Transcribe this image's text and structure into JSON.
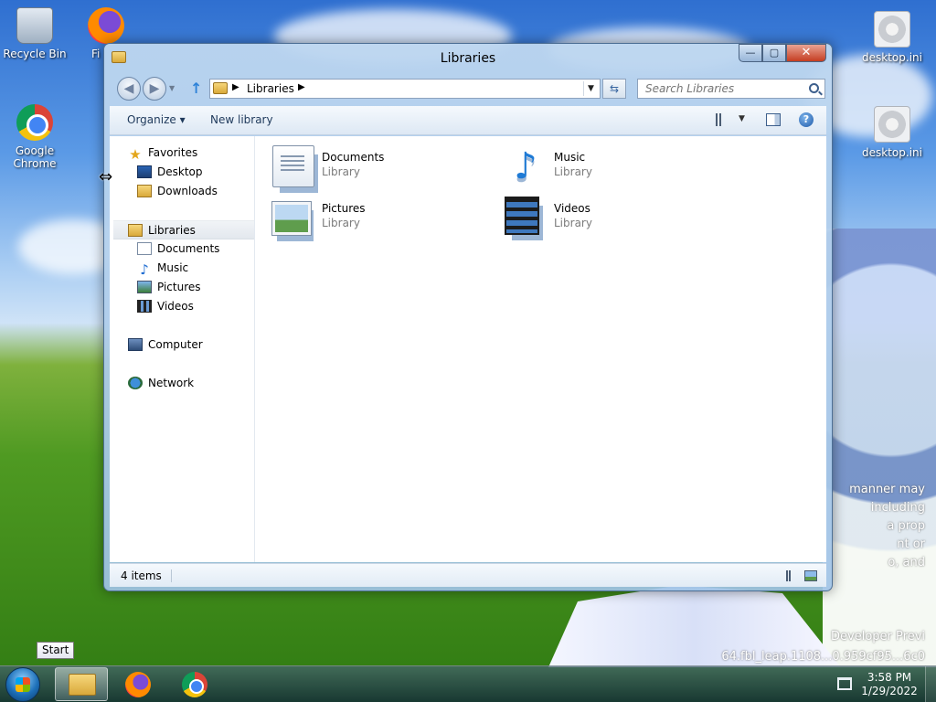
{
  "desktop": {
    "icons": [
      {
        "label": "Recycle Bin"
      },
      {
        "label": "Fi"
      },
      {
        "label": "Google Chrome"
      },
      {
        "label": "desktop.ini"
      },
      {
        "label": "desktop.ini"
      }
    ],
    "watermark": {
      "line1": "manner may",
      "line2": "including",
      "line3": "a prop",
      "line4": "nt or",
      "line5": "o, and",
      "line6": "Developer Previ",
      "line7": "64.fbl_leap.1108...0.959cf95...6c0"
    }
  },
  "window": {
    "title": "Libraries",
    "caption": {
      "minimize": "—",
      "maximize": "▢",
      "close": "✕"
    },
    "nav": {
      "back": "◀",
      "forward": "▶",
      "history": "▼",
      "up": "↑",
      "address_path": "Libraries",
      "refresh": "⇆",
      "search_placeholder": "Search Libraries"
    },
    "toolbar": {
      "organize": "Organize ▾",
      "new_library": "New library",
      "help": "?"
    },
    "navpane": {
      "favorites": "Favorites",
      "desktop": "Desktop",
      "downloads": "Downloads",
      "libraries": "Libraries",
      "documents": "Documents",
      "music": "Music",
      "pictures": "Pictures",
      "videos": "Videos",
      "computer": "Computer",
      "network": "Network"
    },
    "libraries": [
      {
        "name": "Documents",
        "type": "Library"
      },
      {
        "name": "Music",
        "type": "Library"
      },
      {
        "name": "Pictures",
        "type": "Library"
      },
      {
        "name": "Videos",
        "type": "Library"
      }
    ],
    "status": {
      "items": "4 items"
    }
  },
  "taskbar": {
    "tooltip": "Start",
    "clock": {
      "time": "3:58 PM",
      "date": "1/29/2022"
    }
  },
  "colors": {
    "window_frame": "#4d6f95",
    "close_button": "#c53d21",
    "accent": "#1e395b"
  }
}
